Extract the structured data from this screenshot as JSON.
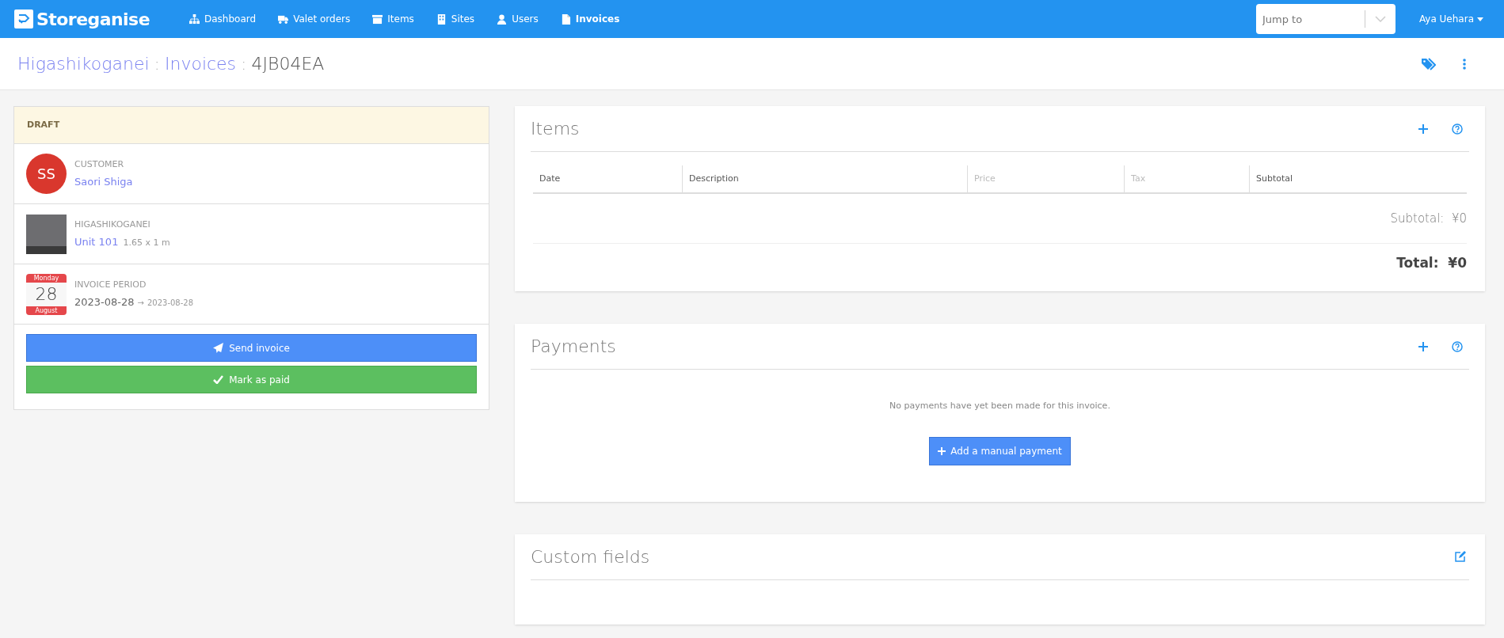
{
  "navbar": {
    "logo": "Storeganise",
    "items": [
      {
        "label": "Dashboard",
        "kind": "sitemap",
        "selected": false
      },
      {
        "label": "Valet orders",
        "kind": "truck",
        "selected": false
      },
      {
        "label": "Items",
        "kind": "archive",
        "selected": false
      },
      {
        "label": "Sites",
        "kind": "building",
        "selected": false
      },
      {
        "label": "Users",
        "kind": "user",
        "selected": false
      },
      {
        "label": "Invoices",
        "kind": "file",
        "selected": true
      }
    ],
    "jump_to": {
      "placeholder": "Jump to"
    },
    "user": "Aya Uehara"
  },
  "breadcrumb": {
    "links": [
      "Higashikoganei",
      "Invoices"
    ],
    "current": "4JB04EA",
    "separator": ":"
  },
  "invoice_card": {
    "status": "DRAFT",
    "customer": {
      "label": "CUSTOMER",
      "initials": "SS",
      "name": "Saori Shiga"
    },
    "site": {
      "label": "HIGASHIKOGANEI",
      "unit": "Unit 101",
      "size": "1.65 x 1 m"
    },
    "period": {
      "label": "INVOICE PERIOD",
      "weekday": "Monday",
      "day": "28",
      "month": "August",
      "start": "2023-08-28",
      "arrow": "→",
      "end": "2023-08-28"
    },
    "buttons": [
      {
        "label": "Send invoice",
        "kind": "send"
      },
      {
        "label": "Mark as paid",
        "kind": "paid"
      }
    ]
  },
  "items": {
    "title": "Items",
    "columns": [
      {
        "label": "Date",
        "muted": false
      },
      {
        "label": "Description",
        "muted": false
      },
      {
        "label": "Price",
        "muted": true
      },
      {
        "label": "Tax",
        "muted": true
      },
      {
        "label": "Subtotal",
        "muted": false
      }
    ],
    "subtotal": "Subtotal:  ¥0",
    "total": "Total:  ¥0"
  },
  "payments": {
    "title": "Payments",
    "empty_message": "No payments have yet been made for this invoice.",
    "button": "Add a manual payment"
  },
  "custom_fields": {
    "title": "Custom fields"
  }
}
